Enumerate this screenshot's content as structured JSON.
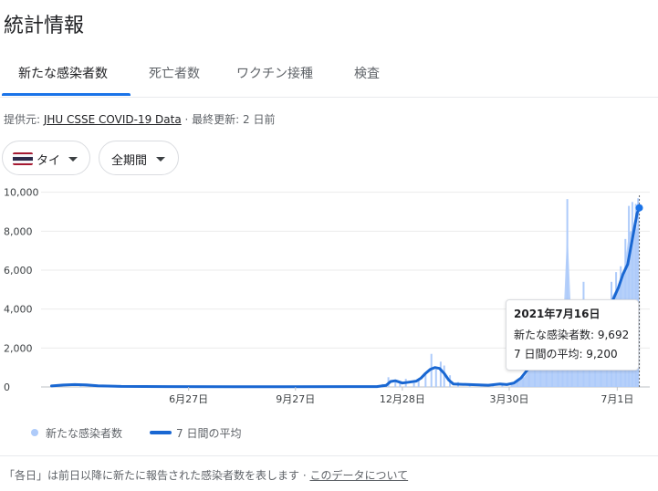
{
  "title": "統計情報",
  "tabs": [
    {
      "label": "新たな感染者数",
      "active": true
    },
    {
      "label": "死亡者数",
      "active": false
    },
    {
      "label": "ワクチン接種",
      "active": false
    },
    {
      "label": "検査",
      "active": false
    }
  ],
  "source": {
    "prefix": "提供元: ",
    "link": "JHU CSSE COVID-19 Data",
    "separator": " · ",
    "updated": "最終更新: 2 日前"
  },
  "filters": {
    "country": "タイ",
    "period": "全期間"
  },
  "colors": {
    "accent": "#1a73e8",
    "line": "#1967d2",
    "bars": "#aecbfa",
    "flag": [
      "#a51931",
      "#f4f5f8",
      "#2d2a4a",
      "#f4f5f8",
      "#a51931"
    ]
  },
  "tooltip": {
    "date": "2021年7月16日",
    "new_cases": "新たな感染者数: 9,692",
    "avg": "7 日間の平均: 9,200"
  },
  "chart_data": {
    "type": "bar",
    "title": "",
    "xlabel": "",
    "ylabel": "",
    "ylim": [
      0,
      10500
    ],
    "yticks": [
      0,
      2000,
      4000,
      6000,
      8000,
      10000
    ],
    "ytick_labels": [
      "0",
      "2,000",
      "4,000",
      "6,000",
      "8,000",
      "10,000"
    ],
    "xticks": [
      {
        "label": "6月27日",
        "day": 118
      },
      {
        "label": "9月27日",
        "day": 210
      },
      {
        "label": "12月28日",
        "day": 302
      },
      {
        "label": "3月30日",
        "day": 394
      },
      {
        "label": "7月1日",
        "day": 487
      }
    ],
    "x_range": [
      -9,
      515
    ],
    "grid": true,
    "legend_position": "bottom-left",
    "series": [
      {
        "name": "新たな感染者数",
        "kind": "bars",
        "points": [
          [
            25,
            60
          ],
          [
            30,
            110
          ],
          [
            35,
            90
          ],
          [
            285,
            150
          ],
          [
            290,
            500
          ],
          [
            296,
            250
          ],
          [
            300,
            300
          ],
          [
            305,
            420
          ],
          [
            312,
            200
          ],
          [
            316,
            350
          ],
          [
            322,
            700
          ],
          [
            327,
            1700
          ],
          [
            331,
            900
          ],
          [
            335,
            1300
          ],
          [
            338,
            1100
          ],
          [
            343,
            600
          ],
          [
            350,
            250
          ],
          [
            360,
            150
          ],
          [
            370,
            120
          ],
          [
            380,
            150
          ],
          [
            388,
            180
          ],
          [
            396,
            140
          ],
          [
            401,
            300
          ],
          [
            406,
            500
          ],
          [
            411,
            1000
          ],
          [
            416,
            1500
          ],
          [
            421,
            2000
          ],
          [
            426,
            2500
          ],
          [
            431,
            2800
          ],
          [
            436,
            2600
          ],
          [
            440,
            2900
          ],
          [
            444,
            9650
          ],
          [
            448,
            3200
          ],
          [
            453,
            3000
          ],
          [
            458,
            5400
          ],
          [
            463,
            3500
          ],
          [
            468,
            3800
          ],
          [
            473,
            3300
          ],
          [
            478,
            4200
          ],
          [
            482,
            5400
          ],
          [
            486,
            5900
          ],
          [
            490,
            6200
          ],
          [
            494,
            7600
          ],
          [
            497,
            9300
          ],
          [
            500,
            9500
          ],
          [
            503,
            9400
          ],
          [
            505,
            9692
          ]
        ]
      },
      {
        "name": "7 日間の平均",
        "kind": "line",
        "points": [
          [
            0,
            50
          ],
          [
            10,
            100
          ],
          [
            20,
            120
          ],
          [
            30,
            110
          ],
          [
            40,
            60
          ],
          [
            60,
            30
          ],
          [
            100,
            20
          ],
          [
            200,
            10
          ],
          [
            280,
            20
          ],
          [
            288,
            80
          ],
          [
            292,
            280
          ],
          [
            296,
            320
          ],
          [
            302,
            200
          ],
          [
            308,
            250
          ],
          [
            314,
            300
          ],
          [
            318,
            450
          ],
          [
            322,
            700
          ],
          [
            326,
            900
          ],
          [
            330,
            1000
          ],
          [
            334,
            950
          ],
          [
            338,
            700
          ],
          [
            342,
            350
          ],
          [
            346,
            150
          ],
          [
            360,
            120
          ],
          [
            376,
            90
          ],
          [
            386,
            150
          ],
          [
            392,
            120
          ],
          [
            398,
            200
          ],
          [
            404,
            450
          ],
          [
            410,
            900
          ],
          [
            416,
            1450
          ],
          [
            422,
            1900
          ],
          [
            428,
            2200
          ],
          [
            434,
            2450
          ],
          [
            440,
            2650
          ],
          [
            446,
            2850
          ],
          [
            452,
            3050
          ],
          [
            458,
            3250
          ],
          [
            464,
            3400
          ],
          [
            470,
            3550
          ],
          [
            476,
            3800
          ],
          [
            482,
            4300
          ],
          [
            488,
            5100
          ],
          [
            492,
            5800
          ],
          [
            496,
            6300
          ],
          [
            500,
            7600
          ],
          [
            504,
            8900
          ],
          [
            506,
            9200
          ]
        ]
      }
    ],
    "highlight": {
      "day": 506,
      "value": 9200
    }
  },
  "legend": {
    "bars_label": "新たな感染者数",
    "line_label": "7 日間の平均"
  },
  "footer": {
    "note": "「各日」は前日以降に新たに報告された感染者数を表します",
    "separator": " · ",
    "link": "このデータについて"
  }
}
